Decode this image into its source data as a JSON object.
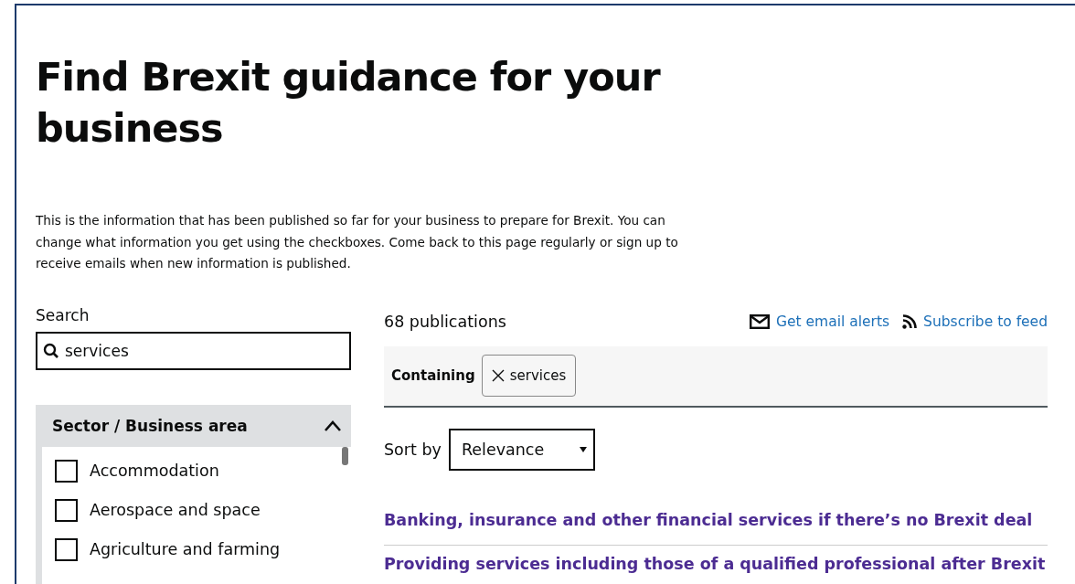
{
  "heading": "Find Brexit guidance for your business",
  "intro": "This is the information that has been published so far for your business to prepare for Brexit. You can change what information you get using the checkboxes. Come back to this page regularly or sign up to receive emails when new information is published.",
  "search": {
    "label": "Search",
    "value": "services"
  },
  "filter": {
    "title": "Sector / Business area",
    "expanded": true,
    "options": [
      {
        "label": "Accommodation",
        "checked": false
      },
      {
        "label": "Aerospace and space",
        "checked": false
      },
      {
        "label": "Agriculture and farming",
        "checked": false
      }
    ]
  },
  "results": {
    "count": "68 publications",
    "links": [
      "Get email alerts",
      "Subscribe to feed"
    ],
    "facet": {
      "label": "Containing",
      "tag": "services"
    },
    "sort": {
      "label": "Sort by",
      "value": "Relevance"
    },
    "items": [
      "Banking, insurance and other financial services if there’s no Brexit deal",
      "Providing services including those of a qualified professional after Brexit"
    ]
  }
}
